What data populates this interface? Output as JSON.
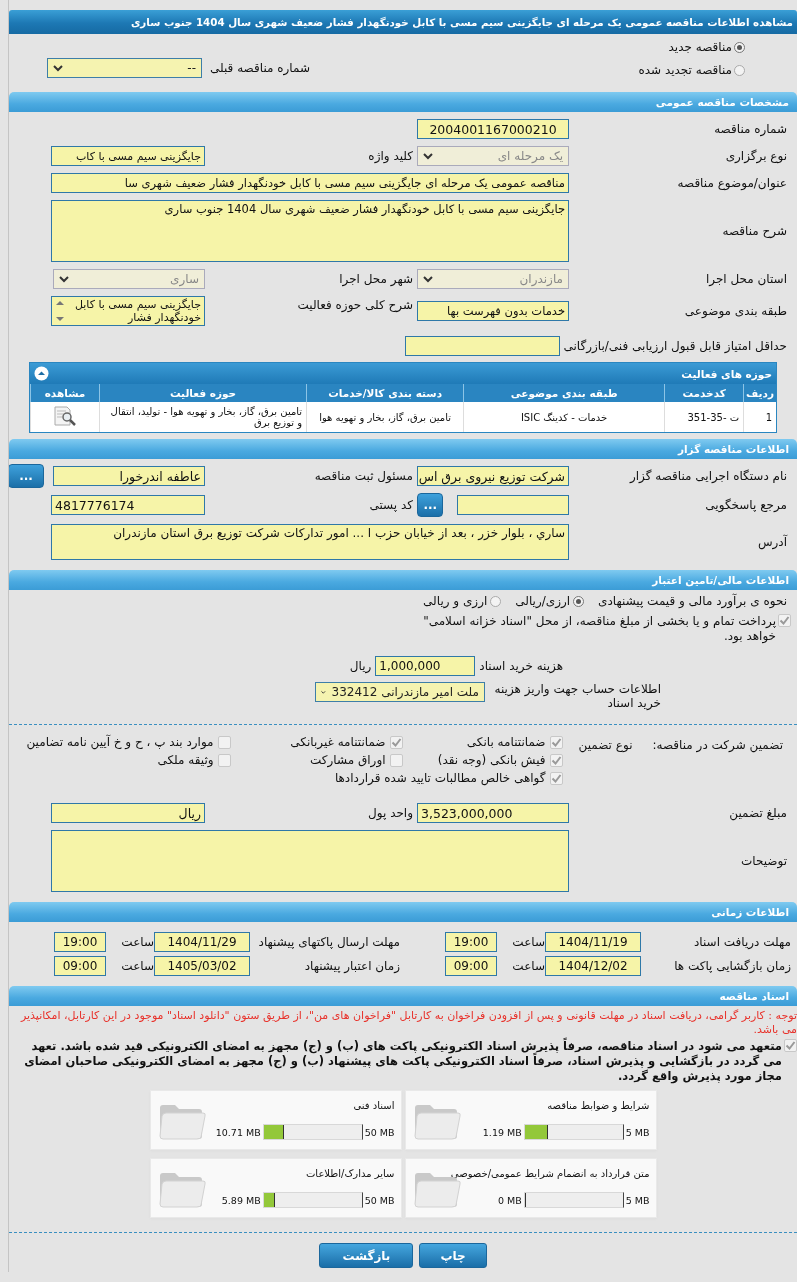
{
  "title": "مشاهده اطلاعات مناقصه عمومی یک مرحله ای جایگزینی سیم مسی با کابل خودنگهدار فشار ضعیف شهری سال 1404 جنوب ساری",
  "tender_kind": [
    {
      "label": "مناقصه جدید",
      "selected": true
    },
    {
      "label": "مناقصه تجدید شده",
      "selected": false
    }
  ],
  "previous_tender": {
    "label": "شماره مناقصه قبلی",
    "value": "--",
    "disabled": false
  },
  "general": {
    "heading": "مشخصات مناقصه عمومی",
    "tender_number": {
      "label": "شماره مناقصه",
      "value": "2004001167000210"
    },
    "holding_type": {
      "label": "نوع برگزاری",
      "value": "یک مرحله ای",
      "disabled": true
    },
    "keyword": {
      "label": "کلید واژه",
      "value": "جایگزینی سیم مسی با کاب"
    },
    "subject": {
      "label": "عنوان/موضوع مناقصه",
      "value": "مناقصه عمومی یک مرحله ای جایگزینی سیم مسی با کابل خودنگهدار فشار ضعیف شهری سا"
    },
    "description": {
      "label": "شرح مناقصه",
      "value": "جایگزینی سیم مسی با کابل خودنگهدار فشار ضعیف شهری سال 1404 جنوب ساری"
    },
    "province": {
      "label": "استان محل اجرا",
      "value": "مازندران",
      "disabled": true
    },
    "city": {
      "label": "شهر محل اجرا",
      "value": "ساری",
      "disabled": true
    },
    "category": {
      "label": "طبقه بندی موضوعی",
      "value": "خدمات بدون فهرست بها"
    },
    "activity_summary": {
      "label": "شرح کلی حوزه فعالیت",
      "value": "جایگزینی سیم مسی با کابل خودنگهدار فشار"
    },
    "min_score": {
      "label": "حداقل امتیاز قابل قبول ارزیابی فنی/بازرگانی"
    }
  },
  "activities": {
    "heading": "حوزه های فعالیت",
    "expanded": true,
    "columns": [
      "ردیف",
      "کدخدمت",
      "طبقه بندی موضوعی",
      "دسته بندی کالا/خدمات",
      "حوزه فعالیت",
      "مشاهده"
    ],
    "rows": [
      {
        "cells": [
          "1",
          "ت -35-351",
          "خدمات - کدینگ ISIC",
          "تامین برق، گاز، بخار و تهویه هوا",
          "تامین برق، گاز، بخار و تهویه هوا - تولید، انتقال و توزیع برق"
        ]
      }
    ]
  },
  "organizer": {
    "heading": "اطلاعات مناقصه گزار",
    "agency": {
      "label": "نام دستگاه اجرایی مناقصه گزار",
      "value": "شرکت توزیع نیروی برق اس"
    },
    "registrar": {
      "label": "مسئول ثبت مناقصه",
      "value": "عاطفه اندرخورا",
      "button": "..."
    },
    "reference": {
      "label": "مرجع پاسخگویی",
      "button": "..."
    },
    "postal_code": {
      "label": "کد پستی",
      "value": "4817776174"
    },
    "address": {
      "label": "آدرس",
      "value": "ساري ، بلوار خزر ، بعد از خیابان حزب ا ... امور تدارکات شرکت توزیع برق استان مازندران"
    }
  },
  "finance": {
    "heading": "اطلاعات مالی/تامین اعتبار",
    "estimate": {
      "label": "نحوه ی برآورد مالی و قیمت پیشنهادی",
      "options": [
        {
          "label": "ارزی/ریالی",
          "selected": true
        },
        {
          "label": "ارزی و ریالی",
          "selected": false
        }
      ]
    },
    "treasury": {
      "checked": true,
      "text": "پرداخت تمام و یا بخشی از مبلغ مناقصه، از محل \"اسناد خزانه اسلامی\" خواهد بود."
    },
    "doc_fee": {
      "label": "هزینه خرید اسناد",
      "value": "1,000,000",
      "unit": "ریال"
    },
    "account": {
      "label": "اطلاعات حساب جهت واریز هزینه خرید اسناد",
      "value": "ملت امیر مازندرانی 332412",
      "disabled": false
    }
  },
  "guarantee": {
    "label": "تضمین شرکت در مناقصه:",
    "type_label": "نوع تضمین",
    "options": [
      {
        "label": "ضمانتنامه بانکی",
        "checked": true
      },
      {
        "label": "ضمانتنامه غیربانکی",
        "checked": true
      },
      {
        "label": "موارد بند پ ، ح و خ آیین نامه تضامین",
        "checked": false
      },
      {
        "label": "فیش بانکی (وجه نقد)",
        "checked": true
      },
      {
        "label": "اوراق مشارکت",
        "checked": false
      },
      {
        "label": "وثیقه ملکی",
        "checked": false
      },
      {
        "label": "گواهی خالص مطالبات تایید شده قراردادها",
        "checked": true
      }
    ],
    "amount": {
      "label": "مبلغ تضمین",
      "value": "3,523,000,000"
    },
    "currency": {
      "label": "واحد پول",
      "value": "ریال"
    },
    "notes": {
      "label": "توضیحات"
    }
  },
  "timing": {
    "heading": "اطلاعات زمانی",
    "rows": [
      {
        "label": "مهلت دریافت اسناد",
        "date": "1404/11/19",
        "time_label": "ساعت",
        "time": "19:00"
      },
      {
        "label": "مهلت ارسال پاکتهای پیشنهاد",
        "date": "1404/11/29",
        "time_label": "ساعت",
        "time": "19:00"
      },
      {
        "label": "زمان بازگشایی پاکت ها",
        "date": "1404/12/02",
        "time_label": "ساعت",
        "time": "09:00"
      },
      {
        "label": "زمان اعتبار پیشنهاد",
        "date": "1405/03/02",
        "time_label": "ساعت",
        "time": "09:00"
      }
    ]
  },
  "documents": {
    "heading": "اسناد مناقصه",
    "notice": "توجه : کاربر گرامی، دریافت اسناد در مهلت قانونی و پس از افزودن فراخوان به کارتابل \"فراخوان های من\"، از طریق ستون \"دانلود اسناد\" موجود در این کارتابل، امکانپذیر می باشد.",
    "commitment": {
      "checked": true,
      "text": "متعهد می شود در اسناد مناقصه، صرفاً پذیرش اسناد الکترونیکی پاکت های (ب) و (ج) مجهز به امضای الکترونیکی قید شده باشد. تعهد می گردد در بازگشایی و پذیرش اسناد، صرفاً اسناد الکترونیکی پاکت های پیشنهاد (ب) و (ج) مجهز به امضای الکترونیکی صاحبان امضای مجاز مورد پذیرش واقع گردد."
    },
    "files": [
      {
        "name": "شرایط و ضوابط مناقصه",
        "max": "5 MB",
        "size": "1.19 MB",
        "level": 0.24
      },
      {
        "name": "اسناد فنی",
        "max": "50 MB",
        "size": "10.71 MB",
        "level": 0.21
      },
      {
        "name": "متن قرارداد به انضمام شرایط عمومی/خصوصی",
        "max": "5 MB",
        "size": "0 MB",
        "level": 0
      },
      {
        "name": "سایر مدارک/اطلاعات",
        "max": "50 MB",
        "size": "5.89 MB",
        "level": 0.12
      }
    ]
  },
  "buttons": [
    "چاپ",
    "بازگشت"
  ]
}
